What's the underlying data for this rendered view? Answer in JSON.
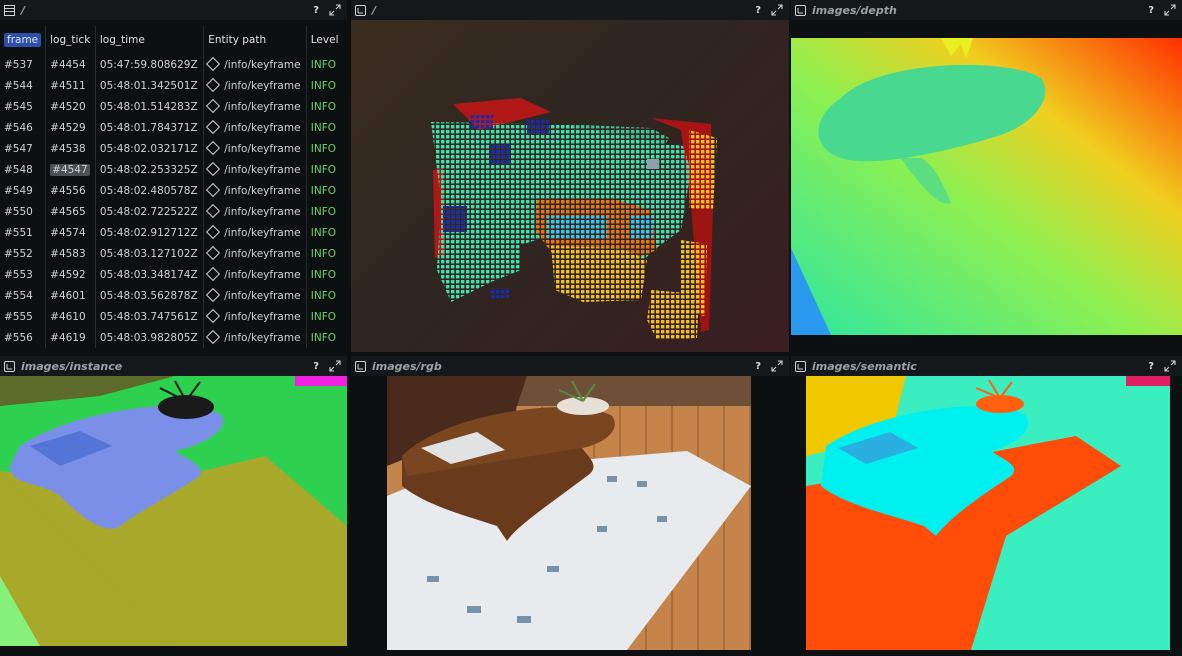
{
  "panels": {
    "table": {
      "title": "/",
      "help": "?"
    },
    "spatial": {
      "title": "/",
      "help": "?"
    },
    "depth": {
      "title": "images/depth",
      "help": "?"
    },
    "instance": {
      "title": "images/instance",
      "help": "?"
    },
    "rgb": {
      "title": "images/rgb",
      "help": "?"
    },
    "semantic": {
      "title": "images/semantic",
      "help": "?"
    }
  },
  "table": {
    "columns": [
      "frame",
      "log_tick",
      "log_time",
      "Entity path",
      "Level"
    ],
    "rows": [
      {
        "frame": "#537",
        "log_tick": "#4454",
        "log_time": "05:47:59.808629Z",
        "entity": "/info/keyframe",
        "level": "INFO"
      },
      {
        "frame": "#544",
        "log_tick": "#4511",
        "log_time": "05:48:01.342501Z",
        "entity": "/info/keyframe",
        "level": "INFO"
      },
      {
        "frame": "#545",
        "log_tick": "#4520",
        "log_time": "05:48:01.514283Z",
        "entity": "/info/keyframe",
        "level": "INFO"
      },
      {
        "frame": "#546",
        "log_tick": "#4529",
        "log_time": "05:48:01.784371Z",
        "entity": "/info/keyframe",
        "level": "INFO"
      },
      {
        "frame": "#547",
        "log_tick": "#4538",
        "log_time": "05:48:02.032171Z",
        "entity": "/info/keyframe",
        "level": "INFO"
      },
      {
        "frame": "#548",
        "log_tick": "#4547",
        "log_time": "05:48:02.253325Z",
        "entity": "/info/keyframe",
        "level": "INFO"
      },
      {
        "frame": "#549",
        "log_tick": "#4556",
        "log_time": "05:48:02.480578Z",
        "entity": "/info/keyframe",
        "level": "INFO"
      },
      {
        "frame": "#550",
        "log_tick": "#4565",
        "log_time": "05:48:02.722522Z",
        "entity": "/info/keyframe",
        "level": "INFO"
      },
      {
        "frame": "#551",
        "log_tick": "#4574",
        "log_time": "05:48:02.912712Z",
        "entity": "/info/keyframe",
        "level": "INFO"
      },
      {
        "frame": "#552",
        "log_tick": "#4583",
        "log_time": "05:48:03.127102Z",
        "entity": "/info/keyframe",
        "level": "INFO"
      },
      {
        "frame": "#553",
        "log_tick": "#4592",
        "log_time": "05:48:03.348174Z",
        "entity": "/info/keyframe",
        "level": "INFO"
      },
      {
        "frame": "#554",
        "log_tick": "#4601",
        "log_time": "05:48:03.562878Z",
        "entity": "/info/keyframe",
        "level": "INFO"
      },
      {
        "frame": "#555",
        "log_tick": "#4610",
        "log_time": "05:48:03.747561Z",
        "entity": "/info/keyframe",
        "level": "INFO"
      },
      {
        "frame": "#556",
        "log_tick": "#4619",
        "log_time": "05:48:03.982805Z",
        "entity": "/info/keyframe",
        "level": "INFO"
      }
    ],
    "highlight": {
      "row": 5,
      "column": "log_tick"
    }
  },
  "colors": {
    "level_info": "#6bd46b",
    "selected_column": "#2c4fa8",
    "panel_bg": "#0d1011",
    "titlebar_bg": "#14181a"
  },
  "icons": [
    "table-icon",
    "spatial3d-icon",
    "image-icon",
    "help-icon",
    "maximize-icon",
    "entity-icon"
  ]
}
